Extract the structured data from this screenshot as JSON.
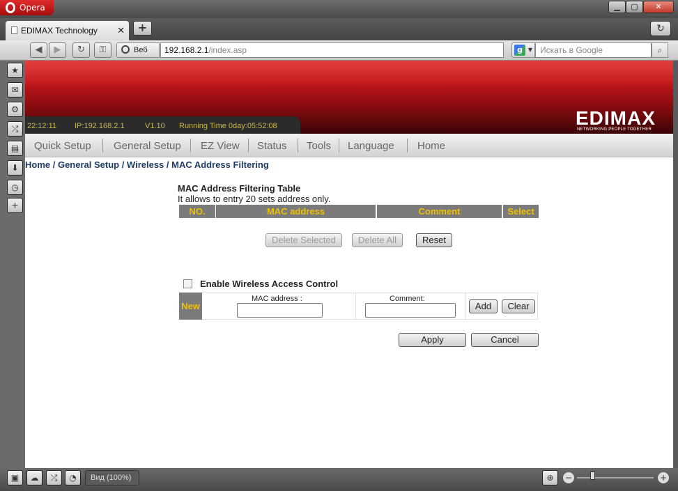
{
  "browser": {
    "app_name": "Opera",
    "tab_title": "EDIMAX Technology",
    "address_scope": "Веб",
    "url_host": "192.168.2.1",
    "url_path": "/index.asp",
    "search_placeholder": "Искать в Google",
    "zoom_label": "Вид (100%)"
  },
  "router": {
    "status": {
      "time": "22:12:11",
      "ip": "IP:192.168.2.1",
      "version": "V1.10",
      "running_time": "Running Time 0day:05:52:08"
    },
    "logo": "EDIMAX",
    "tagline": "NETWORKING PEOPLE TOGETHER",
    "menu": [
      "Quick Setup",
      "General Setup",
      "EZ View",
      "Status",
      "Tools",
      "Language",
      "Home"
    ],
    "breadcrumb": "Home / General Setup / Wireless / MAC Address Filtering",
    "table": {
      "title": "MAC Address Filtering Table",
      "subtitle": "It allows to entry 20 sets address only.",
      "columns": [
        "NO.",
        "MAC address",
        "Comment",
        "Select"
      ]
    },
    "buttons": {
      "delete_selected": "Delete Selected",
      "delete_all": "Delete All",
      "reset": "Reset",
      "add": "Add",
      "clear": "Clear",
      "apply": "Apply",
      "cancel": "Cancel"
    },
    "enable_label": "Enable Wireless Access Control",
    "enable_checked": false,
    "new_row": {
      "label": "New",
      "mac_label": "MAC address :",
      "mac_value": "",
      "comment_label": "Comment:",
      "comment_value": ""
    }
  }
}
